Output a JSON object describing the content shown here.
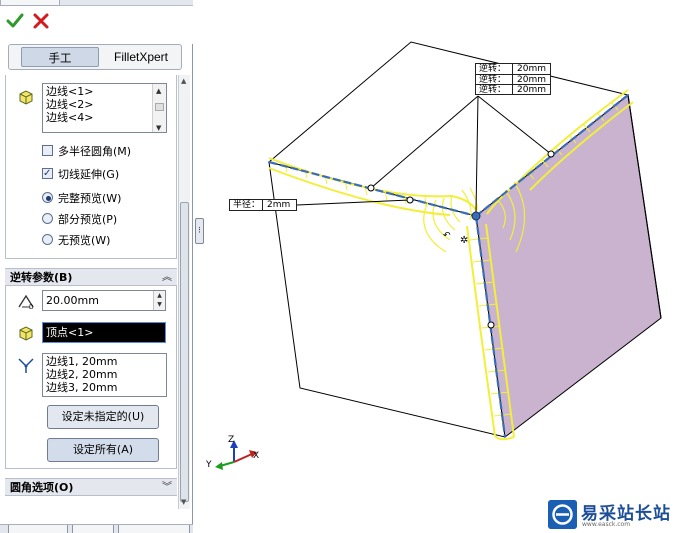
{
  "toolbar": {
    "ok_icon": "checkmark-icon",
    "cancel_icon": "close-icon"
  },
  "tabs": {
    "manual": "手工",
    "filletxpert": "FilletXpert"
  },
  "items_group": {
    "edges": [
      "边线<1>",
      "边线<2>",
      "边线<4>"
    ],
    "multi_radius": "多半径圆角(M)",
    "tangent_propagation": "切线延伸(G)",
    "preview_full": "完整预览(W)",
    "preview_partial": "部分预览(P)",
    "preview_none": "无预览(W)",
    "multi_radius_checked": false,
    "tangent_propagation_checked": true,
    "preview_selected": "full"
  },
  "setback": {
    "header": "逆转参数(B)",
    "distance": "20.00mm",
    "vertex": "顶点<1>",
    "setback_list": [
      "边线1, 20mm",
      "边线2, 20mm",
      "边线3, 20mm"
    ],
    "set_unassigned": "设定未指定的(U)",
    "set_all": "设定所有(A)"
  },
  "fillet_options": {
    "header": "圆角选项(O)"
  },
  "viewport": {
    "setback_callout": [
      {
        "label": "逆转：",
        "value": "20mm"
      },
      {
        "label": "逆转：",
        "value": "20mm"
      },
      {
        "label": "逆转：",
        "value": "20mm"
      }
    ],
    "radius_callout": {
      "label": "半径：",
      "value": "2mm"
    },
    "triad": {
      "x": "X",
      "y": "Y",
      "z": "Z"
    },
    "colors": {
      "fillet_outline": "#f2ef3a",
      "side_face": "#c9b3cf",
      "edge": "#000000"
    }
  },
  "watermark": {
    "title": "易采站长站",
    "subtitle": "www.easck.com",
    "icon": "logo-e-icon"
  }
}
